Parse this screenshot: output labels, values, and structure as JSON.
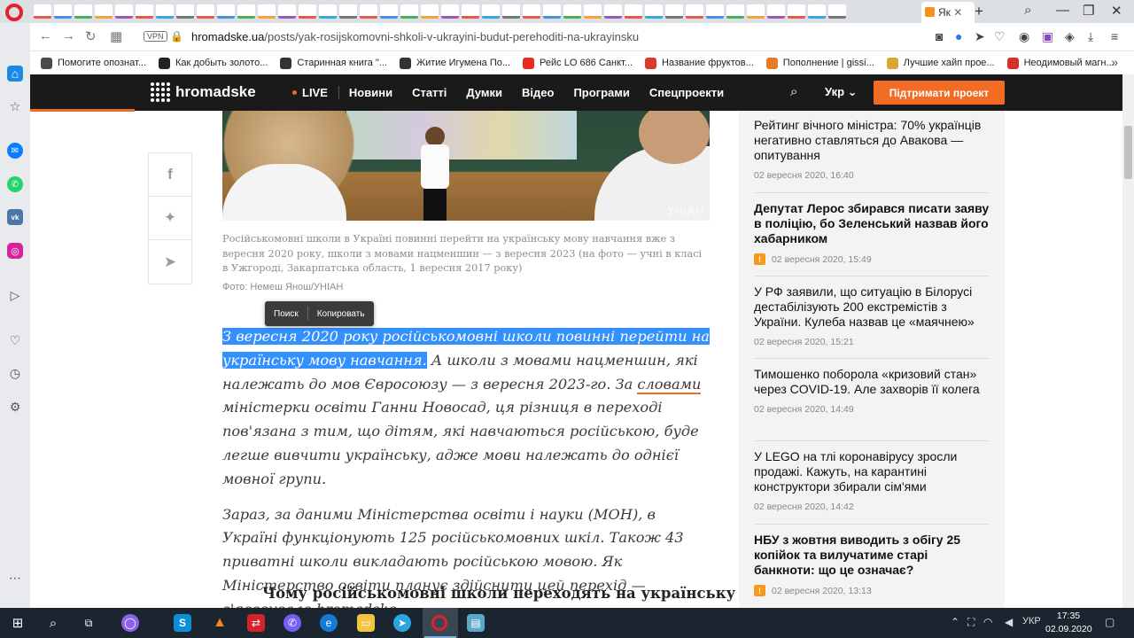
{
  "browser": {
    "active_tab_label": "Як",
    "url_domain": "hromadske.ua",
    "url_path": "/posts/yak-rosijskomovni-shkoli-v-ukrayini-budut-perehoditi-na-ukrayinsku",
    "vpn_label": "VPN",
    "bookmarks": [
      {
        "label": "Помогите опознат...",
        "color": "#4a4a4a"
      },
      {
        "label": "Как добыть золото...",
        "color": "#222"
      },
      {
        "label": "Старинная книга \"...",
        "color": "#333"
      },
      {
        "label": "Житие Игумена По...",
        "color": "#333"
      },
      {
        "label": "Рейс LO 686 Санкт...",
        "color": "#e82d20"
      },
      {
        "label": "Название фруктов...",
        "color": "#d93a2a"
      },
      {
        "label": "Пополнение | gissi...",
        "color": "#e57b2a"
      },
      {
        "label": "Лучшие хайп прое...",
        "color": "#d7a634"
      },
      {
        "label": "Неодимовый магн...",
        "color": "#d8302c"
      }
    ]
  },
  "site": {
    "logo": "hromadske",
    "nav": {
      "live": "LIVE",
      "items": [
        "Новини",
        "Статті",
        "Думки",
        "Відео",
        "Програми",
        "Спецпроекти"
      ]
    },
    "lang": "Укр",
    "support_button": "Підтримати проект"
  },
  "article": {
    "photo_watermark": "УНІАН",
    "caption": "Російськомовні школи в Україні повинні перейти на українську мову навчання вже з вересня 2020 року, школи з мовами нацменшин — з вересня 2023 (на фото — учні в класі в Ужгороді, Закарпатська область, 1 вересня 2017 року)",
    "credit": "Фото: Немеш Янош/УНІАН",
    "context_menu": {
      "search": "Поиск",
      "copy": "Копировать"
    },
    "p1_selected": "З вересня 2020 року російськомовні школи повинні перейти на українську мову навчання.",
    "p1_before_link": " А школи з мовами нацменшин, які належать до мов Євросоюзу — з вересня 2023-го. За ",
    "p1_link": "словами",
    "p1_after_link": " міністерки освіти Ганни Новосад, ця різниця в переході пов'язана з тим, що дітям, які навчаються російською, буде легше вивчити українську, адже мови належать до однієї мовної групи.",
    "p2": "Зараз, за даними Міністерства освіти і науки (МОН), в Україні функціонують 125 російськомовних шкіл. Також 43 приватні школи викладають російською мовою. Як Міністерство освіти планує здійснити цей перехід — з'ясовувало hromadske.",
    "subhead": "Чому російськомовні школи переходять на українську"
  },
  "news": [
    {
      "title": "Рейтинг вічного міністра: 70% українців негативно ставляться до Авакова — опитування",
      "time": "02 вересня 2020, 16:40",
      "bold": false,
      "important": false
    },
    {
      "title": "Депутат Лерос збирався писати заяву в поліцію, бо Зеленський назвав його хабарником",
      "time": "02 вересня 2020, 15:49",
      "bold": true,
      "important": true
    },
    {
      "title": "У РФ заявили, що ситуацію в Білорусі дестабілізують 200 екстремістів з України. Кулеба назвав це «маячнею»",
      "time": "02 вересня 2020, 15:21",
      "bold": false,
      "important": false
    },
    {
      "title": "Тимошенко поборола «кризовий стан» через COVID-19. Але захворів її колега",
      "time": "02 вересня 2020, 14:49",
      "bold": false,
      "important": false
    },
    {
      "title": "У LEGO на тлі коронавірусу зросли продажі. Кажуть, на карантині конструктори збирали сім'ями",
      "time": "02 вересня 2020, 14:42",
      "bold": false,
      "important": false
    },
    {
      "title": "НБУ з жовтня виводить з обігу 25 копійок та вилучатиме старі банкноти: що це означає?",
      "time": "02 вересня 2020, 13:13",
      "bold": true,
      "important": true
    }
  ],
  "taskbar": {
    "lang": "УКР",
    "time": "17:35",
    "date": "02.09.2020"
  }
}
